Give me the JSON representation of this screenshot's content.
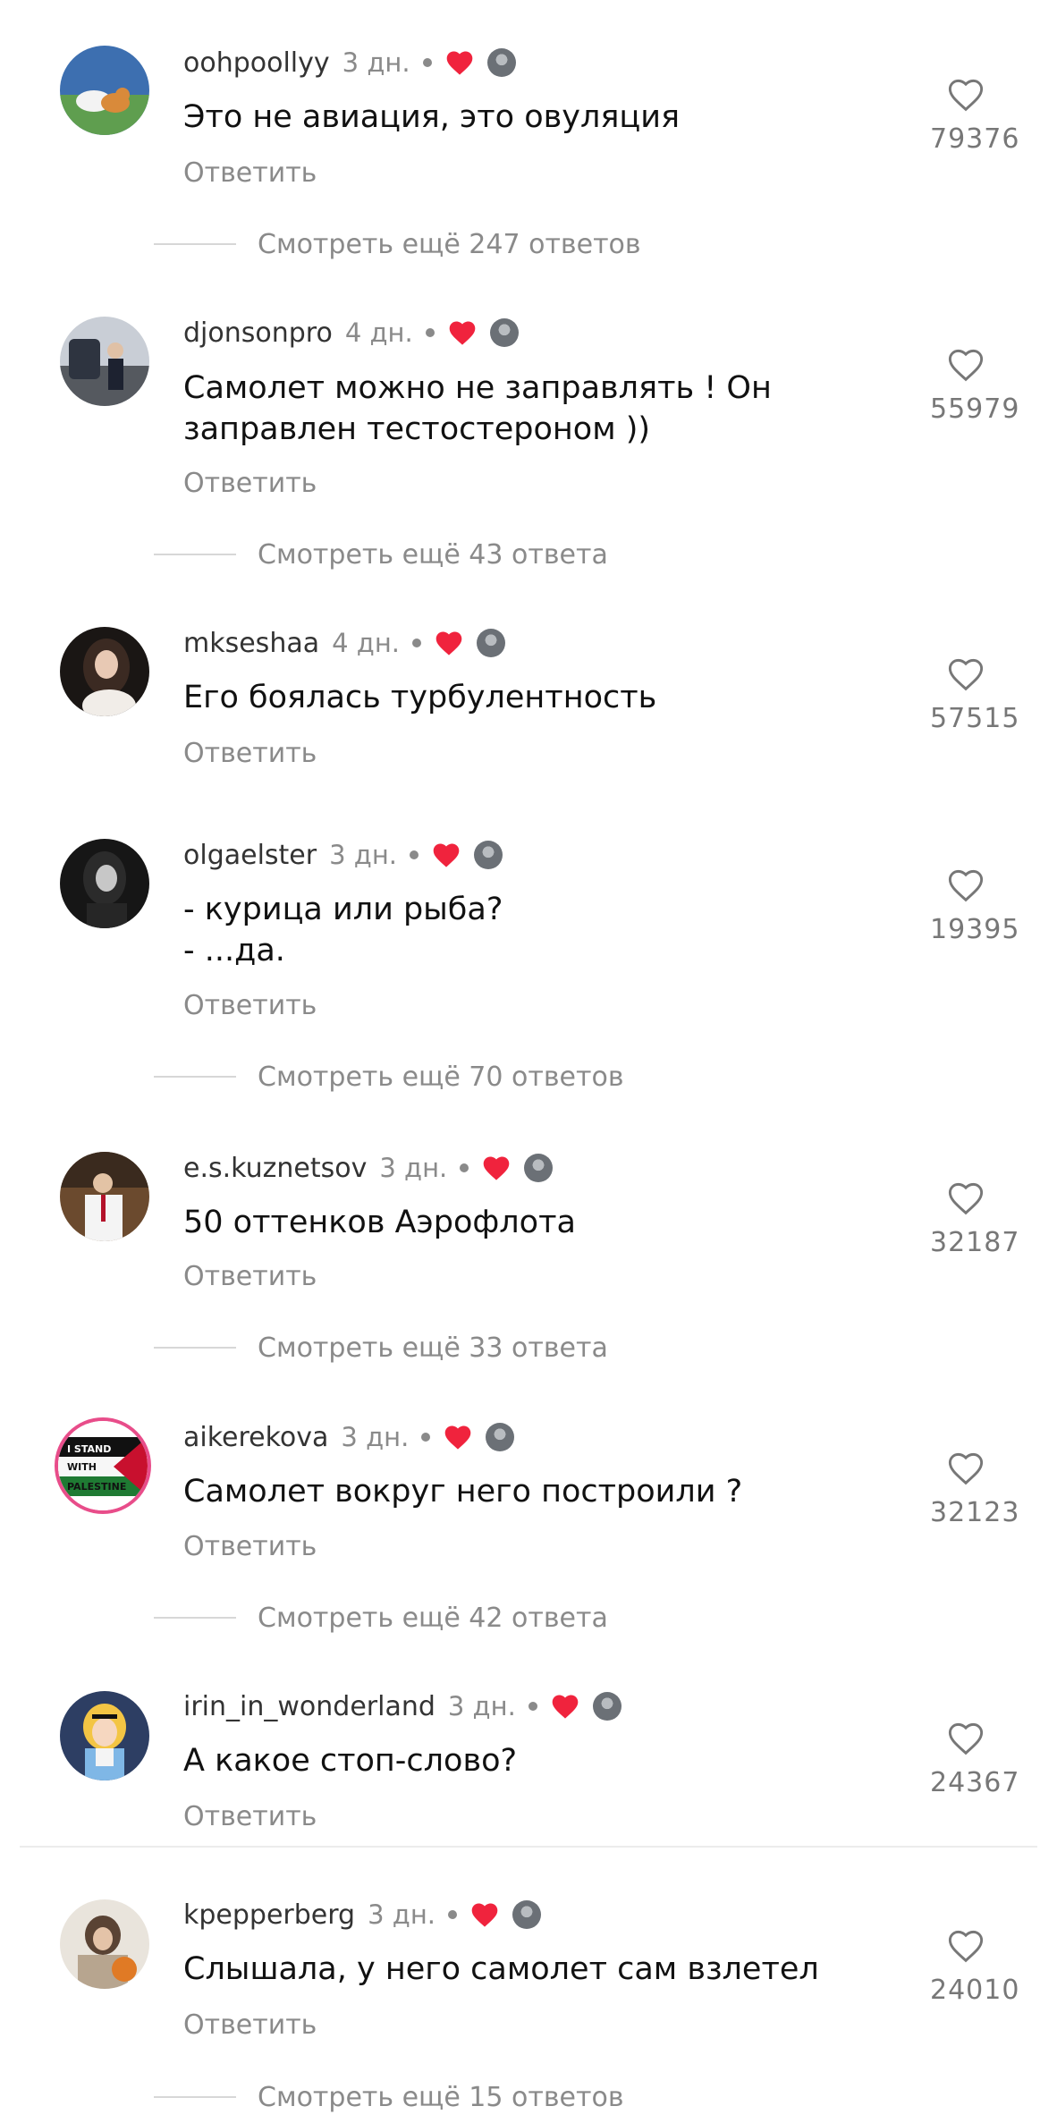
{
  "comments": [
    {
      "username": "oohpoollyy",
      "time": "3 дн.",
      "text": "Это не авиация, это овуляция",
      "reply": "Ответить",
      "likes": "79376",
      "more": "Смотреть ещё 247 ответов"
    },
    {
      "username": "djonsonpro",
      "time": "4 дн.",
      "text": "Самолет можно не заправлять ! Он\nзаправлен тестостероном ))",
      "reply": "Ответить",
      "likes": "55979",
      "more": "Смотреть ещё 43 ответа"
    },
    {
      "username": "mkseshaa",
      "time": "4 дн.",
      "text": "Его боялась турбулентность",
      "reply": "Ответить",
      "likes": "57515"
    },
    {
      "username": "olgaelster",
      "time": "3 дн.",
      "text": "- курица или рыба?\n- ...да.",
      "reply": "Ответить",
      "likes": "19395",
      "more": "Смотреть ещё 70 ответов"
    },
    {
      "username": "e.s.kuznetsov",
      "time": "3 дн.",
      "text": "50 оттенков Аэрофлота",
      "reply": "Ответить",
      "likes": "32187",
      "more": "Смотреть ещё 33 ответа"
    },
    {
      "username": "aikerekova",
      "time": "3 дн.",
      "text": "Самолет вокруг него построили ?",
      "reply": "Ответить",
      "likes": "32123",
      "more": "Смотреть ещё 42 ответа",
      "avatar_text": "I STAND WITH PALESTINE"
    },
    {
      "username": "irin_in_wonderland",
      "time": "3 дн.",
      "text": "А какое стоп-слово?",
      "reply": "Ответить",
      "likes": "24367"
    },
    {
      "username": "kpepperberg",
      "time": "3 дн.",
      "text": "Слышала, у него самолет сам взлетел",
      "reply": "Ответить",
      "likes": "24010",
      "more": "Смотреть ещё 15 ответов"
    }
  ],
  "icons": {
    "like": "heart-outline-icon",
    "creator_like": "heart-filled-icon",
    "creator_avatar": "creator-avatar-icon"
  },
  "colors": {
    "heart": "#f0233d",
    "secondary_text": "#8a8a8a",
    "primary_text": "#111111"
  }
}
